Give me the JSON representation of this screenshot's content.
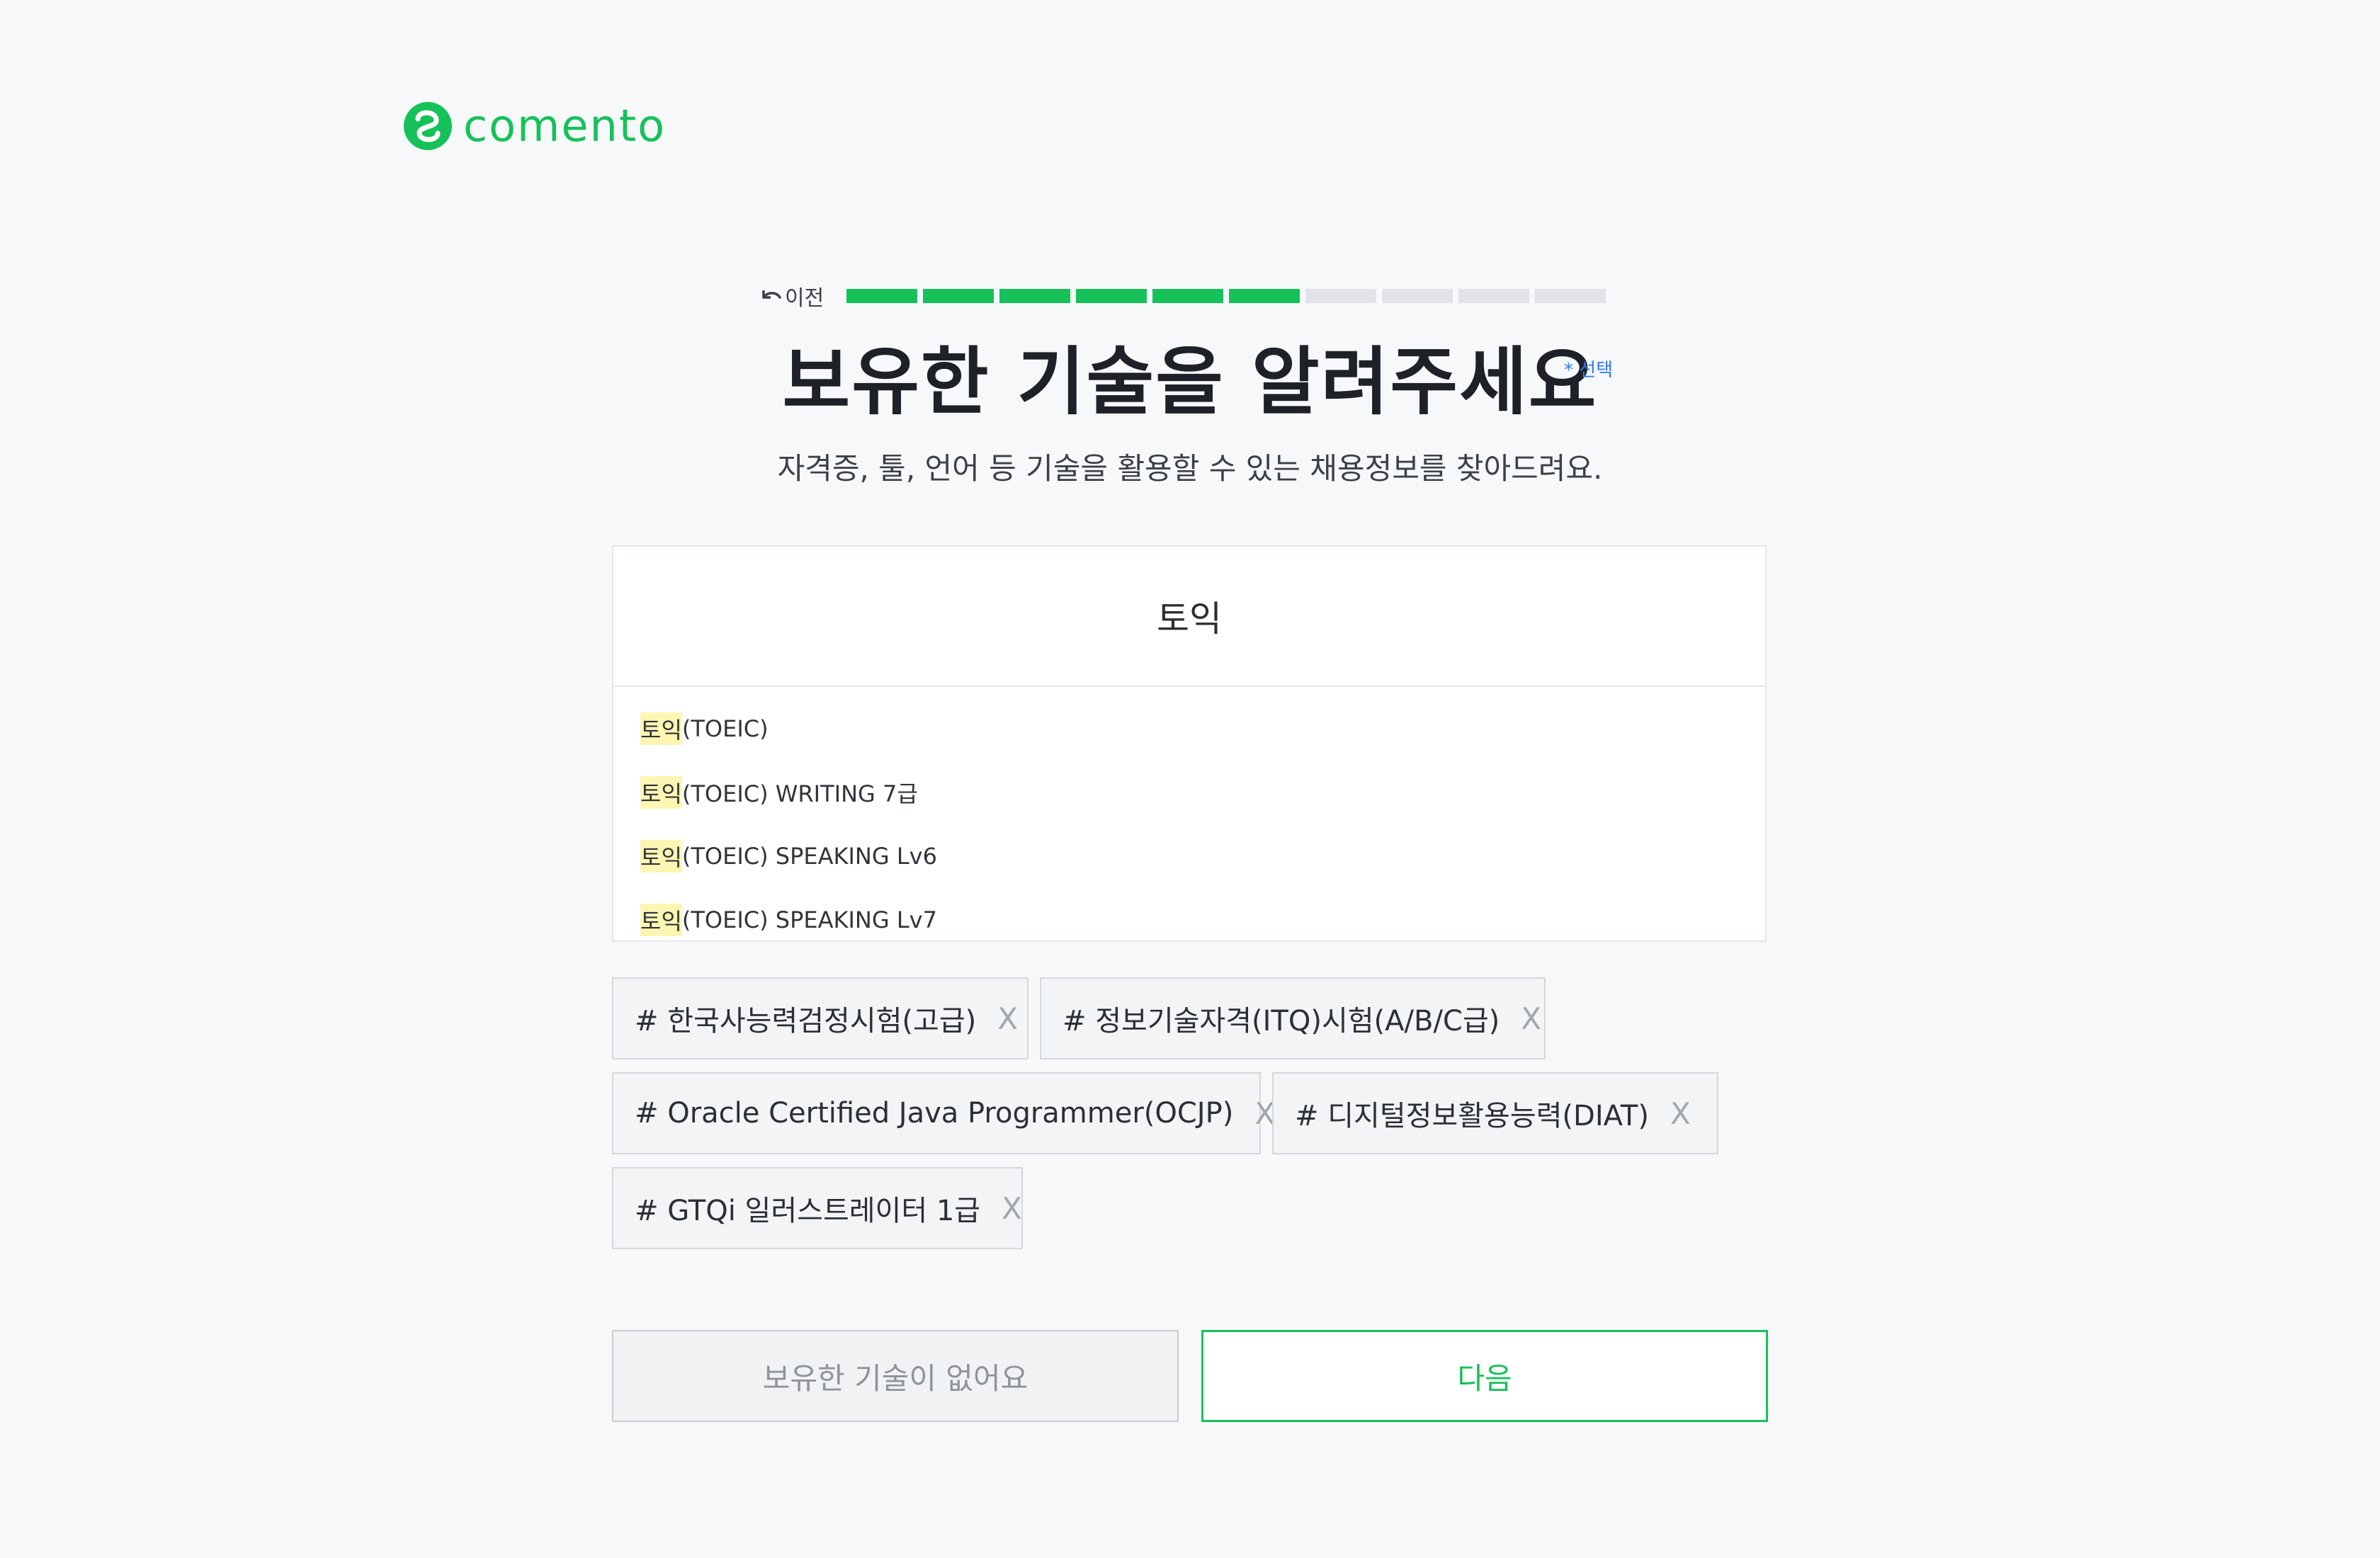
{
  "brand": {
    "logo_text": "comento",
    "accent_color": "#17c15a"
  },
  "nav": {
    "back_label": "이전",
    "back_icon": "undo-arrow-icon"
  },
  "progress": {
    "completed_steps": 6,
    "total_steps": 10
  },
  "header": {
    "title": "보유한 기술을 알려주세요",
    "optional_label": "* 선택",
    "subtitle": "자격증, 툴, 언어 등 기술을 활용할 수 있는 채용정보를 찾아드려요."
  },
  "search": {
    "value": "토익",
    "suggestions": [
      {
        "match": "토익",
        "rest": "(TOEIC)"
      },
      {
        "match": "토익",
        "rest": "(TOEIC) WRITING 7급"
      },
      {
        "match": "토익",
        "rest": "(TOEIC) SPEAKING Lv6"
      },
      {
        "match": "토익",
        "rest": "(TOEIC) SPEAKING Lv7"
      }
    ]
  },
  "selected_tags": [
    {
      "label": "# 한국사능력검정시험(고급)",
      "remove": "X"
    },
    {
      "label": "# 정보기술자격(ITQ)시험(A/B/C급)",
      "remove": "X"
    },
    {
      "label": "# Oracle Certified Java Programmer(OCJP)",
      "remove": "X"
    },
    {
      "label": "# 디지털정보활용능력(DIAT)",
      "remove": "X"
    },
    {
      "label": "# GTQi 일러스트레이터 1급",
      "remove": "X"
    }
  ],
  "actions": {
    "no_skills_label": "보유한 기술이 없어요",
    "next_label": "다음"
  }
}
